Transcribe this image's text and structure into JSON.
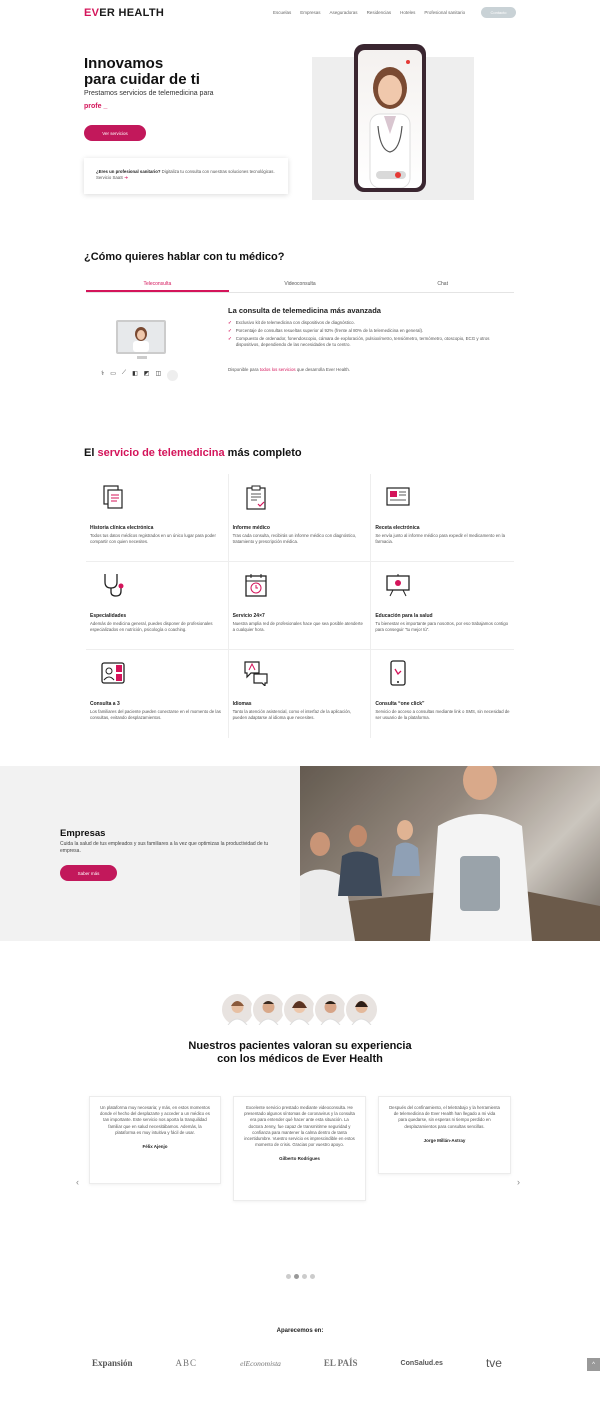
{
  "header": {
    "logo_ev": "EV",
    "logo_rest": "ER HEALTH",
    "nav": [
      "Escuelas",
      "Empresas",
      "Aseguradoras",
      "Residencias",
      "Hoteles",
      "Profesional sanitario"
    ],
    "contact_label": "Contacto"
  },
  "hero": {
    "title_line1": "Innovamos",
    "title_line2": "para cuidar de ti",
    "subtitle": "Prestamos servicios de telemedicina para",
    "typed": "profe _",
    "cta": "Ver servicios",
    "pro_bold": "¿Eres un profesional sanitario?",
    "pro_text": "Digitaliza tu consulta con nuestras soluciones tecnológicas. Servicio SaaS",
    "pro_arrow": "➜"
  },
  "talk": {
    "title": "¿Cómo quieres hablar con tu médico?",
    "tabs": [
      "Teleconsulta",
      "Videoconsulta",
      "Chat"
    ],
    "consult_title": "La consulta de telemedicina más avanzada",
    "bullets": [
      "Exclusivo kit de telemedicina con dispositivos de diagnóstico.",
      "Porcentaje de consultas resueltas superior al 92% (frente al 80% de la telemedicina en general).",
      "Compuesto de ordenador, fonendoscopio, cámara de exploración, pulsioxímetro, tensiómetro, termómetro, otoscopio, ECG y otros dispositivos, dependiendo de las necesidades de tu centro."
    ],
    "available_pre": "Disponible para ",
    "available_link": "todos los servicios",
    "available_post": " que desarrolla Ever Health."
  },
  "services": {
    "title_pre": "El ",
    "title_accent": "servicio de telemedicina",
    "title_post": " más completo",
    "items": [
      {
        "title": "Historia clínica electrónica",
        "text": "Todos tus datos médicos registrados en un único lugar para poder compartir con quien necesites.",
        "icon": "documents-icon"
      },
      {
        "title": "Informe médico",
        "text": "Tras cada consulta, recibirás un informe médico con diagnóstico, tratamiento y prescripción médica.",
        "icon": "clipboard-icon"
      },
      {
        "title": "Receta electrónica",
        "text": "Se envía junto al informe médico para expedir el medicamento en la farmacia.",
        "icon": "prescription-icon"
      },
      {
        "title": "Especialidades",
        "text": "Además de medicina general, puedes disponer de profesionales especializados en nutrición, psicología o coaching.",
        "icon": "stethoscope-icon"
      },
      {
        "title": "Servicio 24×7",
        "text": "Nuestra amplia red de profesionales hace que sea posible atenderte a cualquier hora.",
        "icon": "calendar-clock-icon"
      },
      {
        "title": "Educación para la salud",
        "text": "Tu bienestar es importante para nosotros, por eso trabajamos contigo para conseguir \"tu mejor tú\".",
        "icon": "whiteboard-icon"
      },
      {
        "title": "Consulta a 3",
        "text": "Los familiares del paciente pueden conectarse en el momento de las consultas, evitando desplazamientos.",
        "icon": "video-call-icon"
      },
      {
        "title": "Idiomas",
        "text": "Tanto la atención asistencial, como el interfaz de la aplicación, pueden adaptarse al idioma que necesites.",
        "icon": "translate-icon"
      },
      {
        "title": "Consulta “one click”",
        "text": "Servicio de acceso a consultas mediante link o SMS, sin necesidad de ser usuario de la plataforma.",
        "icon": "smartphone-icon"
      }
    ]
  },
  "empresas": {
    "title": "Empresas",
    "text": "Cuida la salud de tus empleados y sus familiares a la vez que optimizas la productividad de tu empresa.",
    "cta": "Saber más"
  },
  "testimonials": {
    "title_line1": "Nuestros pacientes valoran su experiencia",
    "title_line2": "con los médicos de Ever Health",
    "items": [
      {
        "text": "Un plataforma muy necesaria; y más, en estos momentos donde el hecho del desplazarte y acceder a un médico es tan importante. Este servicio nos aporta la tranquilidad familiar que en salud necesitábamos. Además, la plataforma es muy intuitiva y fácil de usar.",
        "author": "Félix Ajenjo"
      },
      {
        "text": "Excelente servicio prestado mediante videoconsulta. He presentado algunos síntomas de coronavirus y la consulta era para entender qué hacer ante esta situación. La doctora Jenny, fue capaz de transmitirme seguridad y confianza para mantener la calma dentro de tanta incertidumbre. Vuestro servicio es imprescindible en estos momento de crisis. Gracias por vuestro apoyo.",
        "author": "Gilberto Rodrigues"
      },
      {
        "text": "Después del confinamiento, el teletrabajo y la herramienta de telemedicina de Ever Health han llegado a mi vida para quedarse, sin esperas ni tiempo perdido en desplazamientos para consultas sencillas.",
        "author": "Jorge Millán-Astray"
      }
    ],
    "prev": "‹",
    "next": "›"
  },
  "press": {
    "title": "Aparecemos en:",
    "logos": [
      "Expansión",
      "ABC",
      "elEconomista",
      "EL PAÍS",
      "ConSalud.es",
      "tve"
    ]
  },
  "scroll_top": "^",
  "colors": {
    "accent": "#d4145a",
    "button": "#c2185b"
  }
}
